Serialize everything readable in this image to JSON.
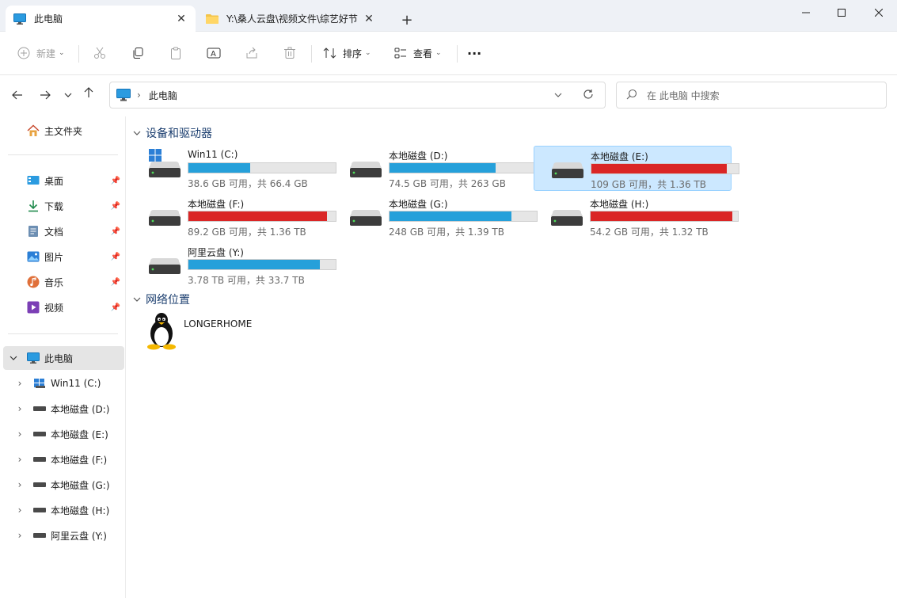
{
  "tabs": [
    {
      "label": "此电脑",
      "icon": "monitor-icon",
      "active": true
    },
    {
      "label": "Y:\\桑人云盘\\视频文件\\综艺好节",
      "icon": "folder-icon",
      "active": false
    }
  ],
  "window": {
    "new_tab": "+"
  },
  "toolbar": {
    "new_label": "新建",
    "sort_label": "排序",
    "view_label": "查看",
    "more_label": "···"
  },
  "address": {
    "path": "此电脑",
    "search_placeholder": "在 此电脑 中搜索"
  },
  "sidebar": {
    "home": "主文件夹",
    "quick": [
      {
        "label": "桌面",
        "icon": "desktop-icon"
      },
      {
        "label": "下载",
        "icon": "download-icon"
      },
      {
        "label": "文档",
        "icon": "document-icon"
      },
      {
        "label": "图片",
        "icon": "picture-icon"
      },
      {
        "label": "音乐",
        "icon": "music-icon"
      },
      {
        "label": "视频",
        "icon": "video-icon"
      }
    ],
    "this_pc": "此电脑",
    "drives": [
      "Win11 (C:)",
      "本地磁盘 (D:)",
      "本地磁盘 (E:)",
      "本地磁盘 (F:)",
      "本地磁盘 (G:)",
      "本地磁盘 (H:)",
      "阿里云盘 (Y:)"
    ]
  },
  "content": {
    "devices_header": "设备和驱动器",
    "network_header": "网络位置",
    "network_item": "LONGERHOME",
    "drives": [
      {
        "name": "Win11 (C:)",
        "info": "38.6 GB 可用，共 66.4 GB",
        "used_fraction": 0.42,
        "color": "#26a0da",
        "selected": false,
        "windows": true
      },
      {
        "name": "本地磁盘 (D:)",
        "info": "74.5 GB 可用，共 263 GB",
        "used_fraction": 0.72,
        "color": "#26a0da",
        "selected": false
      },
      {
        "name": "本地磁盘 (E:)",
        "info": "109 GB 可用，共 1.36 TB",
        "used_fraction": 0.92,
        "color": "#da2626",
        "selected": true
      },
      {
        "name": "本地磁盘 (F:)",
        "info": "89.2 GB 可用，共 1.36 TB",
        "used_fraction": 0.94,
        "color": "#da2626",
        "selected": false
      },
      {
        "name": "本地磁盘 (G:)",
        "info": "248 GB 可用，共 1.39 TB",
        "used_fraction": 0.83,
        "color": "#26a0da",
        "selected": false
      },
      {
        "name": "本地磁盘 (H:)",
        "info": "54.2 GB 可用，共 1.32 TB",
        "used_fraction": 0.96,
        "color": "#da2626",
        "selected": false
      },
      {
        "name": "阿里云盘 (Y:)",
        "info": "3.78 TB 可用，共 33.7 TB",
        "used_fraction": 0.89,
        "color": "#26a0da",
        "selected": false
      }
    ]
  }
}
